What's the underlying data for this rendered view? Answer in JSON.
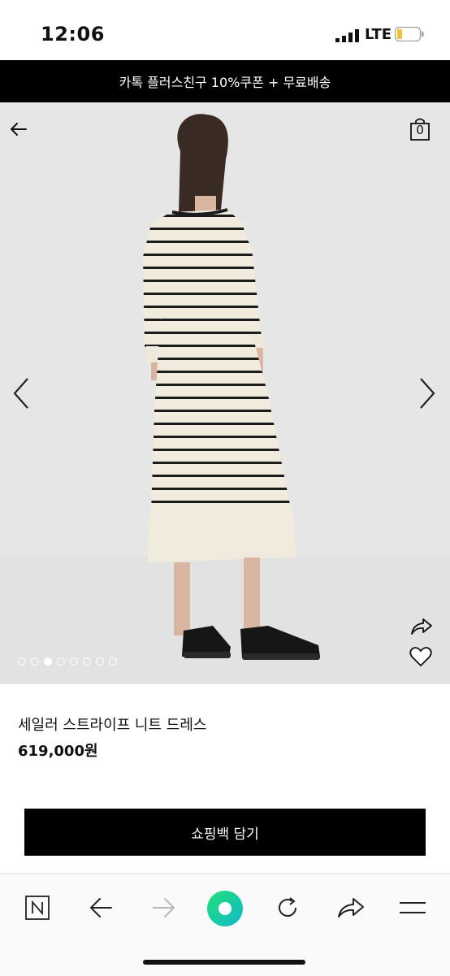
{
  "status_bar": {
    "time": "12:06",
    "network": "LTE",
    "icons": [
      "signal-icon",
      "battery-icon"
    ]
  },
  "promo_banner": {
    "text": "카톡 플러스친구 10%쿠폰 + 무료배송"
  },
  "header": {
    "back_icon": "arrow-left-icon",
    "cart_icon": "shopping-bag-icon",
    "cart_count": "0"
  },
  "gallery": {
    "dot_count": 8,
    "active_index": 2,
    "icons": [
      "chevron-left-icon",
      "chevron-right-icon",
      "share-icon",
      "heart-icon"
    ]
  },
  "product": {
    "name": "세일러 스트라이프 니트 드레스",
    "price": "619,000원"
  },
  "actions": {
    "add_to_cart": "쇼핑백 담기"
  },
  "browser_bar": {
    "items": [
      "naver-n-icon",
      "back-arrow-icon",
      "forward-arrow-icon",
      "green-dot-icon",
      "reload-icon",
      "share-arrow-icon",
      "menu-icon"
    ]
  },
  "colors": {
    "banner": "#000000",
    "button": "#000000",
    "image_bg": "#e6e6e6",
    "green": "#19ce60"
  }
}
